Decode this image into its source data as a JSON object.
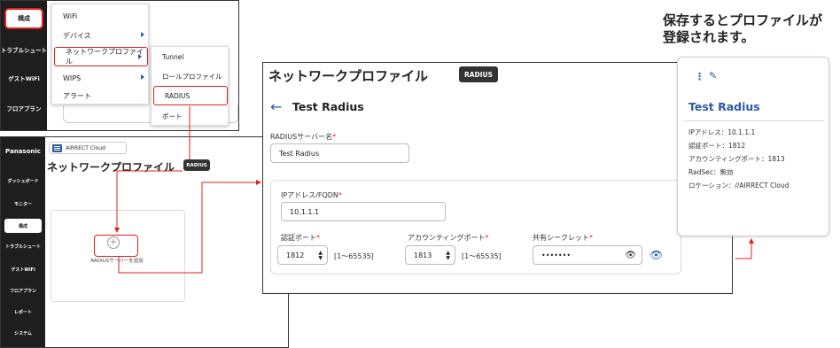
{
  "panel1": {
    "sidebar": [
      "構成",
      "トラブルシュート",
      "ゲストWiFi",
      "フロアプラン"
    ],
    "menu": [
      "WiFi",
      "デバイス",
      "ネットワークプロファイル",
      "WIPS",
      "アラート"
    ],
    "submenu": [
      "Tunnel",
      "ロールプロファイル",
      "RADIUS",
      "ポート"
    ]
  },
  "panel2": {
    "logo": "Panasonic",
    "sidebar": [
      "ダッシュボード",
      "モニター",
      "構成",
      "トラブルシュート",
      "ゲストWiFi",
      "フロアプラン",
      "レポート",
      "システム"
    ],
    "breadcrumb": "AIRRECT Cloud",
    "title": "ネットワークプロファイル",
    "chevron": "⌄",
    "tag": "RADIUS",
    "add_label": "RADIUSサーバーを追加"
  },
  "panel3": {
    "title": "ネットワークプロファイル",
    "chevron": "⌄",
    "tag": "RADIUS",
    "back": "←",
    "subtitle": "Test Radius",
    "server_name_label": "RADIUSサーバー名",
    "server_name_value": "Test Radius",
    "ip_label": "IPアドレス/FQDN",
    "ip_value": "10.1.1.1",
    "auth_port_label": "認証ポート",
    "auth_port_value": "1812",
    "auth_port_range": "[1〜65535]",
    "acct_port_label": "アカウンティングポート",
    "acct_port_value": "1813",
    "acct_port_range": "[1〜65535]",
    "secret_label": "共有シークレット",
    "secret_value": "•••••••",
    "required_mark": "*"
  },
  "panel4": {
    "heading_line1": "保存するとプロファイルが",
    "heading_line2": "登録されます。",
    "name": "Test Radius",
    "ip": "IPアドレス：10.1.1.1",
    "auth_port": "認証ポート：1812",
    "acct_port": "アカウンティングポート：1813",
    "radsec": "RadSec：無効",
    "location": "ロケーション：//AIRRECT Cloud"
  },
  "icons": [
    "plus-circle-icon",
    "chevron-down-icon",
    "back-arrow-icon",
    "stepper-icon",
    "eye-icon",
    "more-vertical-icon",
    "edit-pencil-icon",
    "menu-icon"
  ],
  "colors": {
    "accent": "#2b5aa6",
    "highlight": "#e02020",
    "sidebar": "#1e1e1e"
  }
}
